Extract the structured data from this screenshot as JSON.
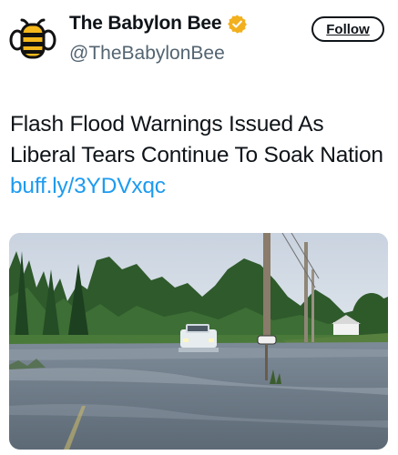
{
  "account": {
    "display_name": "The Babylon Bee",
    "handle": "@TheBabylonBee",
    "verified_icon": "gold-verified-badge-icon",
    "avatar_icon": "bee-logo-icon"
  },
  "follow_button": {
    "label": "Follow"
  },
  "tweet": {
    "text": "Flash Flood Warnings Issued As Liberal Tears Continue To Soak Nation",
    "link": "buff.ly/3YDVxqc"
  },
  "colors": {
    "link": "#1d9bf0",
    "verified_gold": "#f2b01e",
    "logo_yellow": "#f5b81c"
  }
}
